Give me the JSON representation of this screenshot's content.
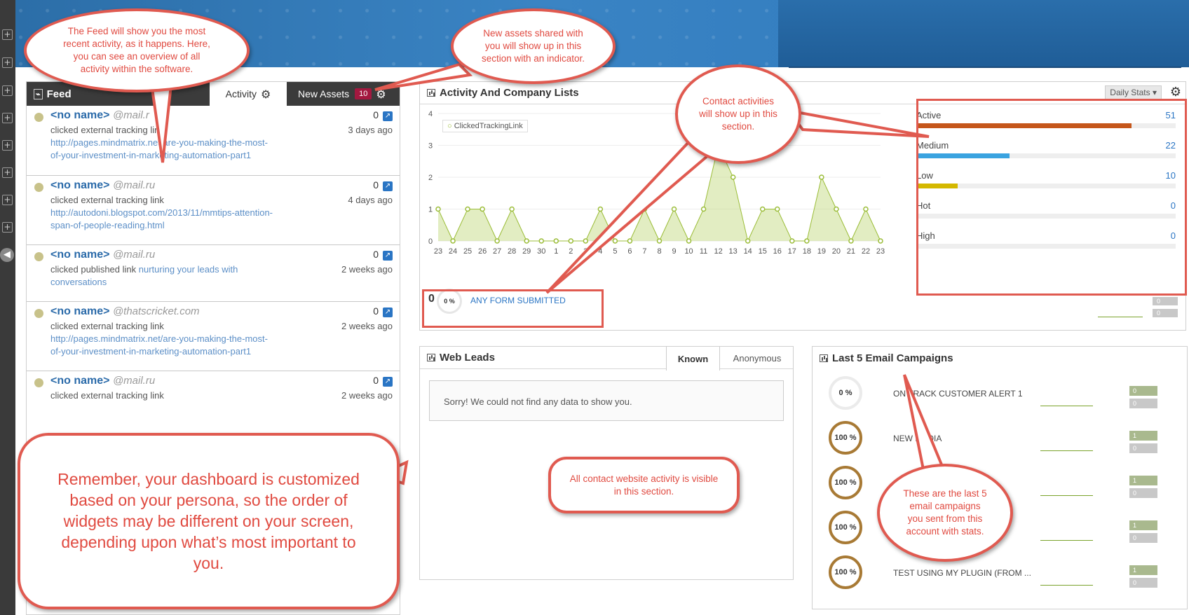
{
  "feed": {
    "title": "Feed",
    "tab_activity": "Activity",
    "tab_new_assets": "New Assets",
    "new_assets_count": "10",
    "items": [
      {
        "name": "<no name>",
        "domain": "@mail.r",
        "action": "clicked external tracking link",
        "link": "http://pages.mindmatrix.net/are-you-making-the-most-of-your-investment-in-marketing-automation-part1",
        "count": "0",
        "time": "3 days ago"
      },
      {
        "name": "<no name>",
        "domain": "@mail.ru",
        "action": "clicked external tracking link",
        "link": "http://autodoni.blogspot.com/2013/11/mmtips-attention-span-of-people-reading.html",
        "count": "0",
        "time": "4 days ago"
      },
      {
        "name": "<no name>",
        "domain": "@mail.ru",
        "action": "clicked published link",
        "link": "nurturing your leads with conversations",
        "count": "0",
        "time": "2 weeks ago"
      },
      {
        "name": "<no name>",
        "domain": "@thatscricket.com",
        "action": "clicked external tracking link",
        "link": "http://pages.mindmatrix.net/are-you-making-the-most-of-your-investment-in-marketing-automation-part1",
        "count": "0",
        "time": "2 weeks ago"
      },
      {
        "name": "<no name>",
        "domain": "@mail.ru",
        "action": "clicked external tracking link",
        "link": "",
        "count": "0",
        "time": "2 weeks ago"
      }
    ]
  },
  "activity": {
    "title": "Activity And Company Lists",
    "daily_stats": "Daily Stats ▾",
    "legend": "ClickedTrackingLink",
    "stats": [
      {
        "label": "Active",
        "value": "51",
        "fraction": 0.83,
        "color": "#c5561a"
      },
      {
        "label": "Medium",
        "value": "22",
        "fraction": 0.36,
        "color": "#3aa3e0"
      },
      {
        "label": "Low",
        "value": "10",
        "fraction": 0.16,
        "color": "#d4b800"
      },
      {
        "label": "Hot",
        "value": "0",
        "fraction": 0,
        "color": "#cccccc"
      },
      {
        "label": "High",
        "value": "0",
        "fraction": 0,
        "color": "#cccccc"
      }
    ],
    "form_count": "0",
    "form_percent": "0 %",
    "form_label": "ANY FORM SUBMITTED",
    "mini_bar_top": "0",
    "mini_bar_bottom": "0"
  },
  "chart_data": {
    "type": "area",
    "x": [
      "23",
      "24",
      "25",
      "26",
      "27",
      "28",
      "29",
      "30",
      "1",
      "2",
      "3",
      "4",
      "5",
      "6",
      "7",
      "8",
      "9",
      "10",
      "11",
      "12",
      "13",
      "14",
      "15",
      "16",
      "17",
      "18",
      "19",
      "20",
      "21",
      "22",
      "23"
    ],
    "series": [
      {
        "name": "ClickedTrackingLink",
        "values": [
          1,
          0,
          1,
          1,
          0,
          1,
          0,
          0,
          0,
          0,
          0,
          1,
          0,
          0,
          1,
          0,
          1,
          0,
          1,
          3,
          2,
          0,
          1,
          1,
          0,
          0,
          2,
          1,
          0,
          1,
          0
        ]
      }
    ],
    "yticks": [
      "0",
      "1",
      "2",
      "3",
      "4"
    ],
    "ylim": [
      0,
      4
    ],
    "xlabel": "",
    "ylabel": ""
  },
  "web_leads": {
    "title": "Web Leads",
    "tab_known": "Known",
    "tab_anonymous": "Anonymous",
    "empty_message": "Sorry! We could not find any data to show you."
  },
  "campaigns": {
    "title": "Last 5 Email Campaigns",
    "items": [
      {
        "percent": "0 %",
        "name": "ON TRACK CUSTOMER ALERT 1",
        "bar1": "0",
        "bar2": "0",
        "empty": true
      },
      {
        "percent": "100 %",
        "name": "NEW MEDIA",
        "bar1": "1",
        "bar2": "0",
        "empty": false
      },
      {
        "percent": "100 %",
        "name": "",
        "bar1": "1",
        "bar2": "0",
        "empty": false
      },
      {
        "percent": "100 %",
        "name": ")",
        "bar1": "1",
        "bar2": "0",
        "empty": false
      },
      {
        "percent": "100 %",
        "name": "TEST USING MY PLUGIN (FROM ...",
        "bar1": "1",
        "bar2": "0",
        "empty": false
      }
    ]
  },
  "callouts": {
    "feed": "The Feed will show you the most recent activity, as it happens. Here, you can see an overview of all activity within the software.",
    "assets": "New assets shared with you will show up in this section with an indicator.",
    "contact": "Contact activities will show up in this section.",
    "website": "All contact website activity is visible in this section.",
    "campaigns": "These are the last 5 email campaigns you sent from this account with stats.",
    "reminder": "Remember, your dashboard is customized based on your persona, so the order of widgets may be different on your screen, depending upon what’s most important to you."
  },
  "colors": {
    "accent": "#2a75c4",
    "callout": "#e05a50",
    "feed_header": "#3b3b3b"
  }
}
